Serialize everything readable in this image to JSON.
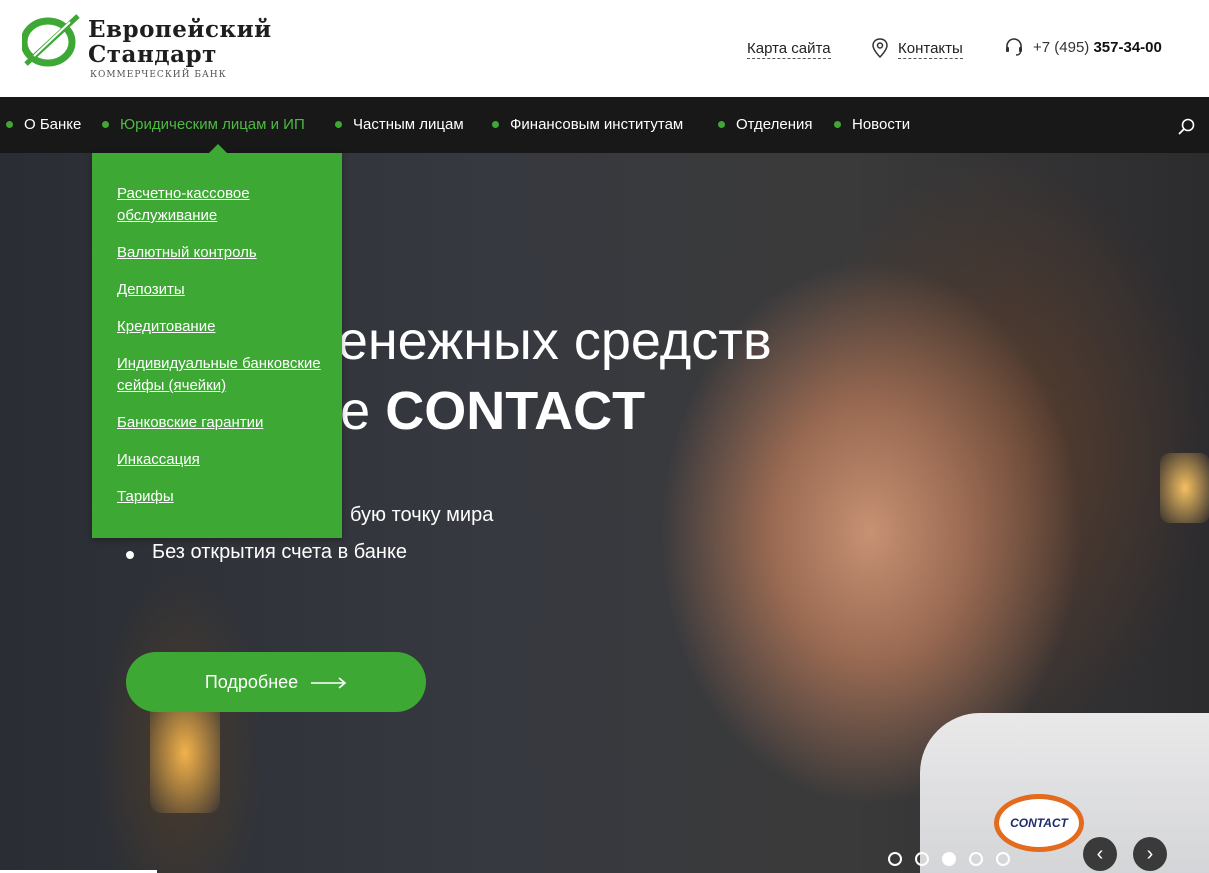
{
  "brand": {
    "name_line1": "Европейский",
    "name_line2": "Стандарт",
    "subtitle": "КОММЕРЧЕСКИЙ БАНК"
  },
  "header": {
    "sitemap": "Карта сайта",
    "contacts": "Контакты",
    "phone_prefix": "+7 (495)",
    "phone_number": "357-34-00"
  },
  "nav": {
    "items": [
      {
        "label": "О Банке"
      },
      {
        "label": "Юридическим лицам и ИП"
      },
      {
        "label": "Частным лицам"
      },
      {
        "label": "Финансовым институтам"
      },
      {
        "label": "Отделения"
      },
      {
        "label": "Новости"
      }
    ]
  },
  "dropdown": {
    "items": [
      {
        "label": "Расчетно-кассовое обслуживание"
      },
      {
        "label": "Валютный контроль"
      },
      {
        "label": "Депозиты"
      },
      {
        "label": "Кредитование"
      },
      {
        "label": "Индивидуальные банковские сейфы (ячейки)"
      },
      {
        "label": "Банковские гарантии"
      },
      {
        "label": "Инкассация"
      },
      {
        "label": "Тарифы"
      }
    ]
  },
  "hero": {
    "title_line1": "ды денежных средств",
    "title_line2_pre": "еме ",
    "title_line2_bold": "CONTACT",
    "bullet1": "бую точку мира",
    "bullet2": "Без открытия счета в банке",
    "button": "Подробнее",
    "partner_logo_text": "CONTACT"
  },
  "slider": {
    "total": 5,
    "active_index": 2,
    "prev": "‹",
    "next": "›"
  },
  "colors": {
    "accent": "#3ea835",
    "nav_bg": "#181818"
  }
}
